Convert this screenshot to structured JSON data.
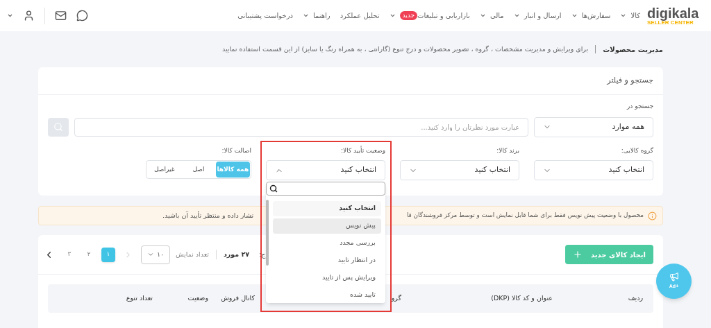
{
  "logo": {
    "name": "digikala",
    "subtitle": "SELLER CENTER"
  },
  "nav": [
    {
      "label": "کالا",
      "has_menu": true
    },
    {
      "label": "سفارش‌ها",
      "has_menu": true
    },
    {
      "label": "ارسال و انبار",
      "has_menu": true
    },
    {
      "label": "مالی",
      "has_menu": true
    },
    {
      "label": "بازاریابی و تبلیغات",
      "badge": "جدید",
      "has_menu": true
    },
    {
      "label": "تحلیل عملکرد",
      "has_menu": false
    },
    {
      "label": "راهنما",
      "has_menu": true
    },
    {
      "label": "درخواست پشتیبانی",
      "has_menu": false
    }
  ],
  "breadcrumb": {
    "title": "مدیریت محصولات",
    "description": "برای ویرایش و مدیریت مشخصات ، گروه ، تصویر محصولات و درج تنوع (گارانتی ، به همراه رنگ یا سایز) از این قسمت استفاده نمایید"
  },
  "search_card": {
    "title": "جستجو و فیلتر",
    "search_label": "جستجو در",
    "scope": "همه موارد",
    "placeholder": "عبارت مورد نظرتان را وارد کنید...",
    "filters": [
      {
        "kind": "select",
        "label": "گروه کالایی:",
        "value": "انتخاب کنید",
        "expanded": false
      },
      {
        "kind": "select",
        "label": "برند کالا:",
        "value": "انتخاب کنید",
        "expanded": false
      },
      {
        "kind": "select",
        "label": "وضعیت تأیید کالا:",
        "value": "انتخاب کنید",
        "expanded": true,
        "highlighted": true,
        "menu": {
          "items": [
            {
              "label": "انتخاب کنید",
              "selected": true,
              "hovered": false
            },
            {
              "label": "پیش نویس",
              "selected": false,
              "hovered": true
            },
            {
              "label": "بررسی مجدد",
              "selected": false,
              "hovered": false
            },
            {
              "label": "در انتظار تایید",
              "selected": false,
              "hovered": false
            },
            {
              "label": "ویرایش پس از تایید",
              "selected": false,
              "hovered": false
            },
            {
              "label": "تایید شده",
              "selected": false,
              "hovered": false
            }
          ]
        }
      },
      {
        "kind": "segmented",
        "label": "اصالت کالا:",
        "options": [
          {
            "label": "همه کالاها",
            "selected": true
          },
          {
            "label": "اصل",
            "selected": false
          },
          {
            "label": "غیراصل",
            "selected": false
          }
        ]
      }
    ]
  },
  "alert": {
    "text_start": "محصول با وضعیت پیش نویس فقط برای شما قابل نمایش است و توسط مرکز فروشندگان قا",
    "text_end": "تشار داده و منتظر تأیید آن باشید."
  },
  "products": {
    "new_button": "ایجاد کالای جدید",
    "results_label": "ج:",
    "results_count": "۲۷ مورد",
    "page_size_label": "تعداد نمایش",
    "page_size": "۱۰",
    "pages": [
      {
        "label": "۱",
        "selected": true
      },
      {
        "label": "۲",
        "selected": false
      },
      {
        "label": "۳",
        "selected": false
      }
    ],
    "columns": [
      "ردیف",
      "عنوان و کد کالا (DKP)",
      "گرو",
      "کانال فروش",
      "وضعیت",
      "تعداد تنوع"
    ]
  },
  "ad_button": "+Ad"
}
